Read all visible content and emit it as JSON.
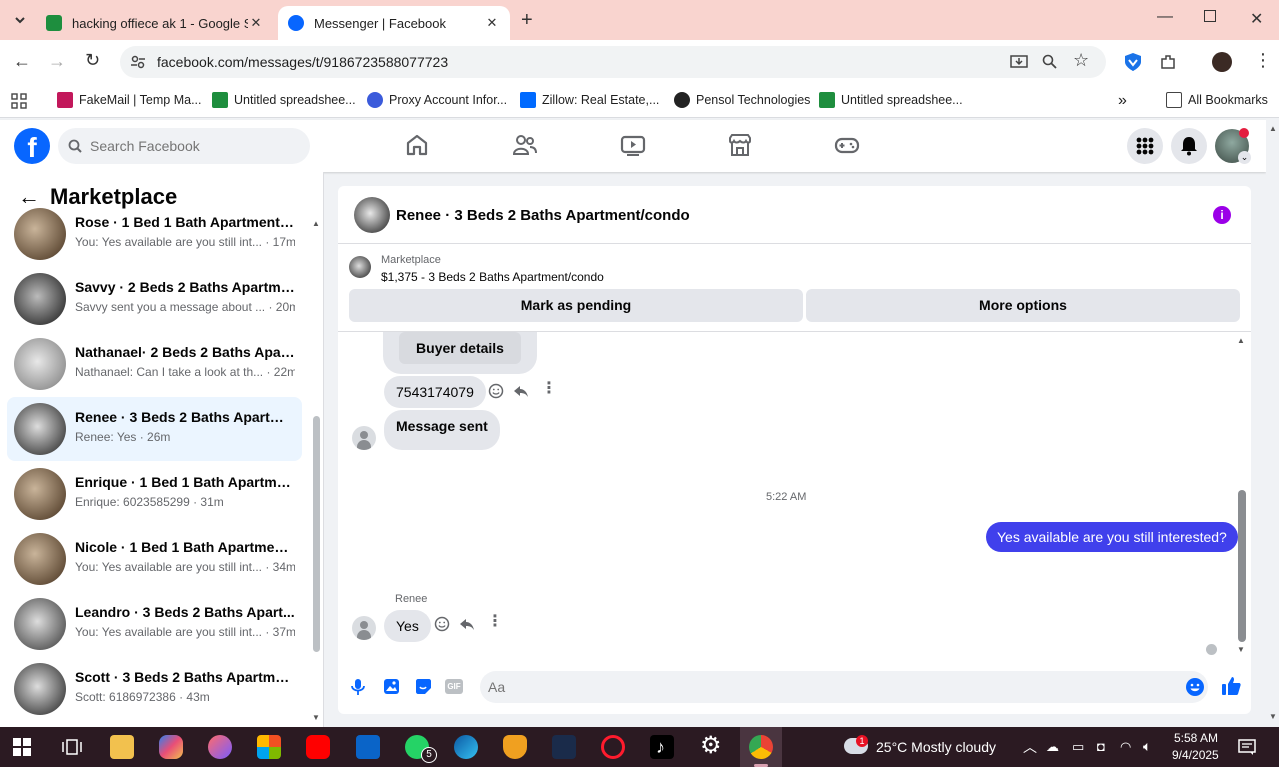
{
  "browser": {
    "tabs": [
      {
        "title": "hacking offiece ak 1 - Google Sl",
        "active": false
      },
      {
        "title": "Messenger | Facebook",
        "active": true
      }
    ],
    "url": "facebook.com/messages/t/9186723588077723",
    "bookmarks": [
      {
        "label": "FakeMail | Temp Ma..."
      },
      {
        "label": "Untitled spreadshee..."
      },
      {
        "label": "Proxy Account Infor..."
      },
      {
        "label": "Zillow: Real Estate,..."
      },
      {
        "label": "Pensol Technologies"
      },
      {
        "label": "Untitled spreadshee..."
      }
    ],
    "all_bookmarks": "All Bookmarks",
    "more": "»"
  },
  "facebook": {
    "search_placeholder": "Search Facebook",
    "logo": "f",
    "accent": "#0866ff"
  },
  "sidebar": {
    "back": "←",
    "title": "Marketplace",
    "conversations": [
      {
        "name": "Rose · 1 Bed 1 Bath Apartment/c...",
        "preview": "You: Yes available are you still int... · 17m",
        "selected": false
      },
      {
        "name": "Savvy · 2 Beds 2 Baths Apartme...",
        "preview": "Savvy sent you a message about ... · 20m",
        "selected": false
      },
      {
        "name": "Nathanael· 2 Beds 2 Baths Apart...",
        "preview": "Nathanael: Can I take a look at th... · 22m",
        "selected": false
      },
      {
        "name": "Renee · 3 Beds 2 Baths Apartme...",
        "preview": "Renee: Yes · 26m",
        "selected": true
      },
      {
        "name": "Enrique · 1 Bed 1 Bath Apartmen...",
        "preview": "Enrique: 6023585299 · 31m",
        "selected": false
      },
      {
        "name": "Nicole · 1 Bed 1 Bath Apartment...",
        "preview": "You: Yes available are you still int... · 34m",
        "selected": false
      },
      {
        "name": "Leandro · 3 Beds 2 Baths Apart...",
        "preview": "You: Yes available are you still int... · 37m",
        "selected": false
      },
      {
        "name": "Scott · 3 Beds 2 Baths Apartmen...",
        "preview": "Scott: 6186972386 · 43m",
        "selected": false
      }
    ]
  },
  "chat": {
    "title": "Renee · 3 Beds 2 Baths Apartment/condo",
    "listing": {
      "source": "Marketplace",
      "summary": "$1,375 - 3 Beds 2 Baths Apartment/condo"
    },
    "actions": {
      "pending": "Mark as pending",
      "more": "More options"
    },
    "messages": {
      "buyer_details": "Buyer details",
      "phone": "7543174079",
      "sent": "Message sent",
      "time": "5:22 AM",
      "outgoing": "Yes available are you still  interested?",
      "sender": "Renee",
      "reply": "Yes"
    },
    "composer_placeholder": "Aa",
    "accent": "#4040ec",
    "info_color": "#9b00e8"
  },
  "taskbar": {
    "weather": "25°C  Mostly cloudy",
    "time": "5:58 AM",
    "date": "9/4/2025",
    "whatsapp_badge": "5",
    "weather_badge": "1"
  }
}
